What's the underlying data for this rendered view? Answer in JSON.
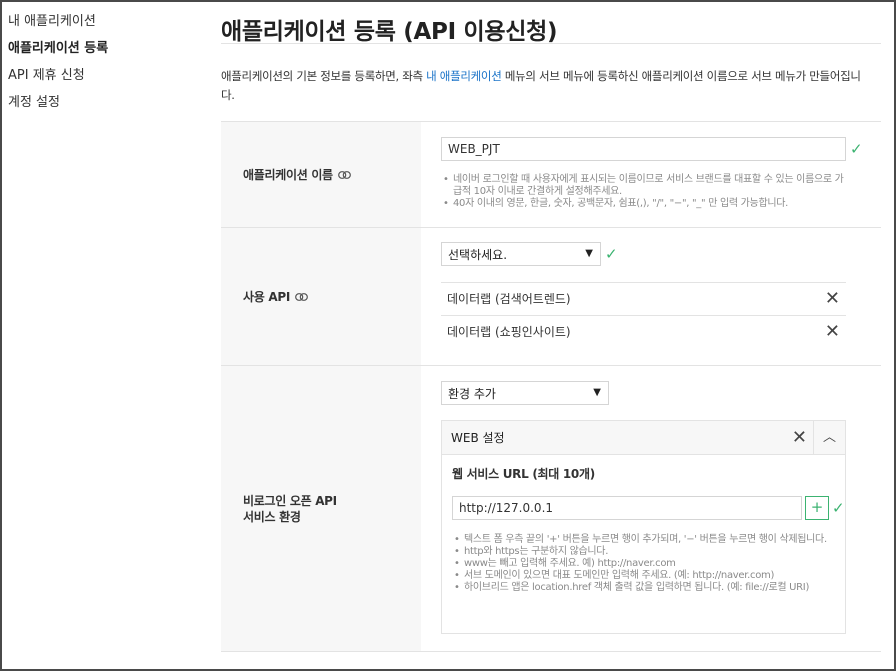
{
  "sidebar": {
    "items": [
      {
        "label": "내 애플리케이션"
      },
      {
        "label": "애플리케이션 등록"
      },
      {
        "label": "API 제휴 신청"
      },
      {
        "label": "계정 설정"
      }
    ]
  },
  "page": {
    "title": "애플리케이션 등록 (API 이용신청)",
    "desc_before": "애플리케이션의 기본 정보를 등록하면, 좌측 ",
    "desc_link": "내 애플리케이션",
    "desc_after": " 메뉴의 서브 메뉴에 등록하신 애플리케이션 이름으로 서브 메뉴가 만들어집니",
    "desc_wrap": "다."
  },
  "app_name": {
    "label": "애플리케이션 이름",
    "value": "WEB_PJT",
    "hints": [
      "네이버 로그인할 때 사용자에게 표시되는 이름이므로 서비스 브랜드를 대표할 수 있는 이름으로 가급적 10자 이내로 간결하게 설정해주세요.",
      "40자 이내의 영문, 한글, 숫자, 공백문자, 쉼표(,), \"/\", \"−\", \"_\" 만 입력 가능합니다."
    ]
  },
  "api": {
    "label": "사용 API",
    "select_value": "선택하세요.",
    "items": [
      {
        "label": "데이터랩 (검색어트렌드)"
      },
      {
        "label": "데이터랩 (쇼핑인사이트)"
      }
    ]
  },
  "env": {
    "label_line1": "비로그인 오픈 API",
    "label_line2": "서비스 환경",
    "select_value": "환경 추가",
    "panel_title": "WEB 설정",
    "sub_title": "웹 서비스 URL (최대 10개)",
    "url_value": "http://127.0.0.1",
    "hints": [
      "텍스트 폼 우측 끝의 '+' 버튼을 누르면 행이 추가되며, '−' 버튼을 누르면 행이 삭제됩니다.",
      "http와 https는 구분하지 않습니다.",
      "www는 빼고 입력해 주세요. 예) http://naver.com",
      "서브 도메인이 있으면 대표 도메인만 입력해 주세요. (예: http://naver.com)",
      "하이브리드 앱은 location.href 객체 출력 값을 입력하면 됩니다. (예: file://로컬 URI)"
    ]
  },
  "colors": {
    "accent_green": "#3cb371",
    "link_blue": "#1a73c8",
    "label_bg": "#f7f7f7"
  }
}
